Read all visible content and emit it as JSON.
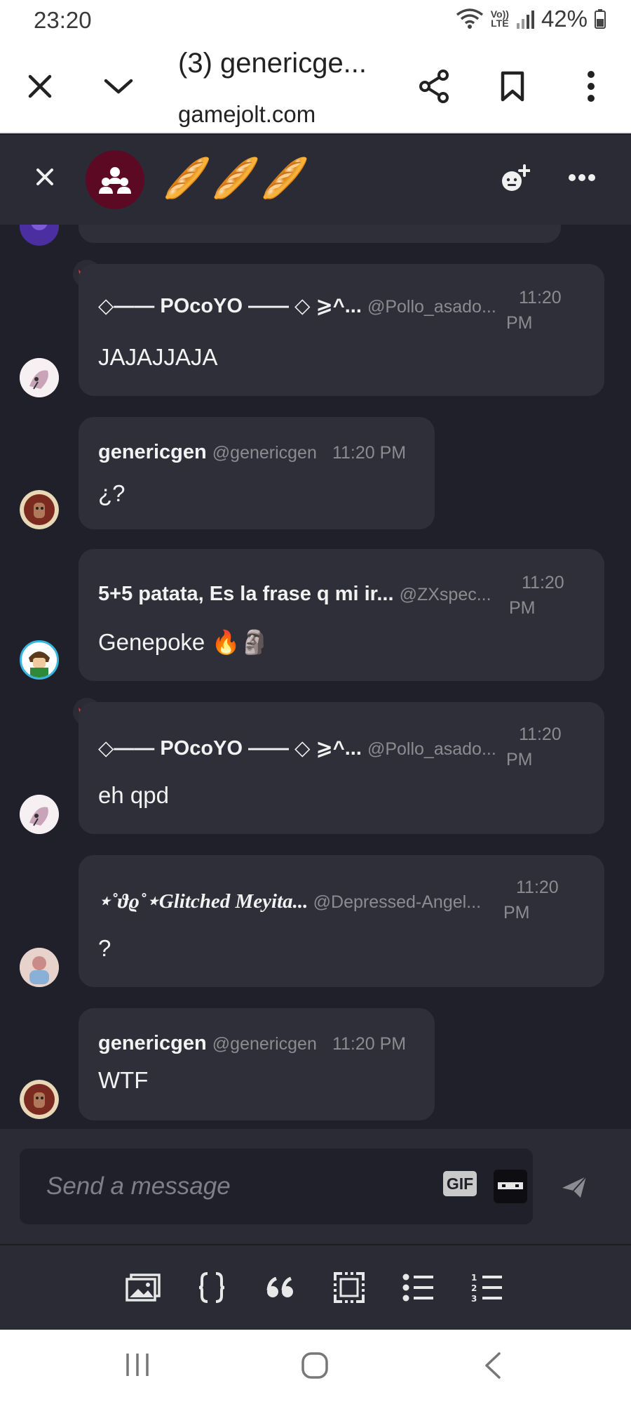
{
  "status_bar": {
    "time": "23:20",
    "network_label_top": "Vo))",
    "network_label_bottom": "LTE",
    "battery": "42%"
  },
  "browser": {
    "title": "(3) genericge...",
    "url": "gamejolt.com",
    "icons": [
      "close-icon",
      "chevron-down-icon",
      "share-icon",
      "bookmark-icon",
      "more-vertical-icon"
    ]
  },
  "chat": {
    "room_title": "🥖🥖🥖",
    "icons": [
      "close-icon",
      "group-icon",
      "add-member-icon",
      "more-horizontal-icon"
    ]
  },
  "messages": [
    {
      "author": "◇—— POcoYO —— ◇ ⩾^...",
      "handle": "@Pollo_asado...",
      "time_top": "11:20",
      "time_bottom": "PM",
      "text": "JAJAJJAJA",
      "crown": true
    },
    {
      "author": "genericgen",
      "handle": "@genericgen",
      "time": "11:20 PM",
      "text": "¿?"
    },
    {
      "author": "5+5 patata, Es la frase q mi ir...",
      "handle": "@ZXspec...",
      "time_top": "11:20",
      "time_bottom": "PM",
      "text": "Genepoke 🔥🗿"
    },
    {
      "author": "◇—— POcoYO —— ◇ ⩾^...",
      "handle": "@Pollo_asado...",
      "time_top": "11:20",
      "time_bottom": "PM",
      "text": "eh qpd",
      "crown": true
    },
    {
      "author": "⋆˚ϑϱ˚⋆Glitched Meyita...",
      "handle": "@Depressed-Angel...",
      "time_top": "11:20",
      "time_bottom": "PM",
      "text": "?"
    },
    {
      "author": "genericgen",
      "handle": "@genericgen",
      "time": "11:20 PM",
      "text": "WTF"
    }
  ],
  "composer": {
    "placeholder": "Send a message",
    "gif_label": "GIF"
  },
  "format_toolbar": [
    "image-icon",
    "code-block-icon",
    "quote-icon",
    "spoiler-icon",
    "bullet-list-icon",
    "numbered-list-icon"
  ],
  "nav": [
    "recent-apps-icon",
    "home-icon",
    "back-icon"
  ]
}
